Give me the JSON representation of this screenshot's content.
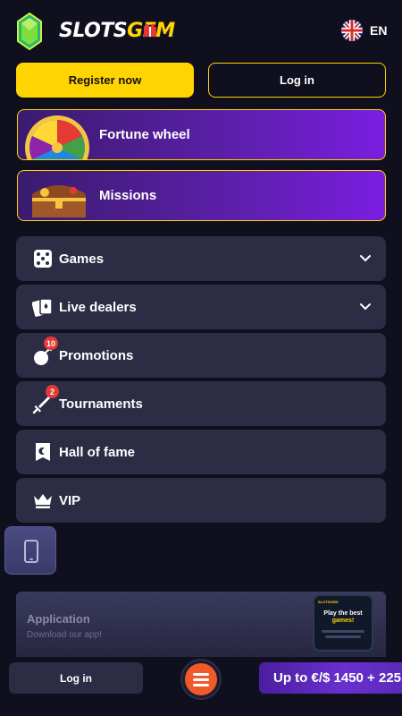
{
  "header": {
    "brand_main": "SLOTS",
    "brand_accent": "GEM",
    "language": "EN"
  },
  "auth": {
    "register_label": "Register now",
    "login_label": "Log in"
  },
  "promos": [
    {
      "title": "Fortune wheel",
      "icon": "fortune-wheel"
    },
    {
      "title": "Missions",
      "icon": "treasure-chest"
    }
  ],
  "menu": [
    {
      "label": "Games",
      "icon": "dice-icon",
      "expandable": true
    },
    {
      "label": "Live dealers",
      "icon": "cards-icon",
      "expandable": true
    },
    {
      "label": "Promotions",
      "icon": "bomb-icon",
      "badge": "10"
    },
    {
      "label": "Tournaments",
      "icon": "sword-icon",
      "badge": "2"
    },
    {
      "label": "Hall of fame",
      "icon": "banner-icon"
    },
    {
      "label": "VIP",
      "icon": "crown-icon"
    }
  ],
  "app": {
    "title": "Application",
    "subtitle": "Download our app!",
    "phone_brand": "SLOTSGEM",
    "phone_text_1": "Play the best",
    "phone_text_2": "games!"
  },
  "bottom": {
    "login_label": "Log in",
    "bonus_label": "Up to €/$ 1450 + 225"
  },
  "colors": {
    "background": "#0f0f1e",
    "accent_yellow": "#ffd400",
    "menu_bg": "#2c2c45",
    "promo_purple": "#6a1fd0",
    "fab_orange": "#f05a28",
    "badge_red": "#e53935"
  }
}
